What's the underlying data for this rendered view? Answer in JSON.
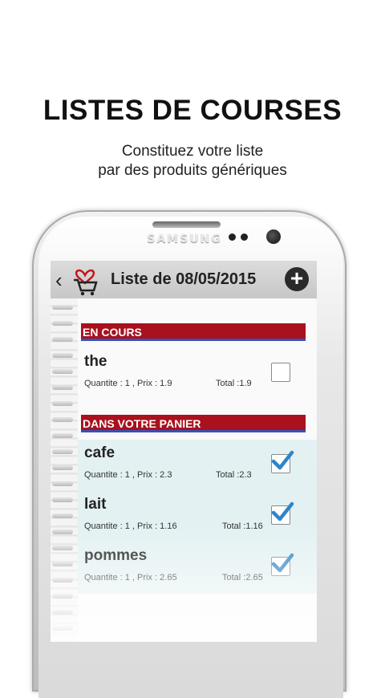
{
  "promo": {
    "headline": "LISTES DE COURSES",
    "subline1": "Constituez votre liste",
    "subline2": "par des produits génériques"
  },
  "device": {
    "brand": "SAMSUNG"
  },
  "appbar": {
    "back_icon": "back-chevron-icon",
    "logo_icon": "shopping-cart-heart-logo",
    "title": "Liste de 08/05/2015",
    "add_icon": "plus-circle-icon"
  },
  "sections": [
    {
      "header": "EN COURS",
      "items": [
        {
          "name": "the",
          "detail": "Quantite : 1 , Prix : 1.9",
          "total": "Total :1.9",
          "checked": false
        }
      ]
    },
    {
      "header": "DANS VOTRE PANIER",
      "items": [
        {
          "name": "cafe",
          "detail": "Quantite : 1 , Prix : 2.3",
          "total": "Total :2.3",
          "checked": true
        },
        {
          "name": "lait",
          "detail": "Quantite : 1 , Prix : 1.16",
          "total": "Total :1.16",
          "checked": true
        },
        {
          "name": "pommes",
          "detail": "Quantite : 1 , Prix : 2.65",
          "total": "Total :2.65",
          "checked": true
        }
      ]
    }
  ],
  "colors": {
    "section_header_bg": "#a8111d",
    "section_header_underline": "#3a4fb8",
    "basket_row_bg": "#e3f1f2",
    "check_color": "#2f84c9"
  }
}
